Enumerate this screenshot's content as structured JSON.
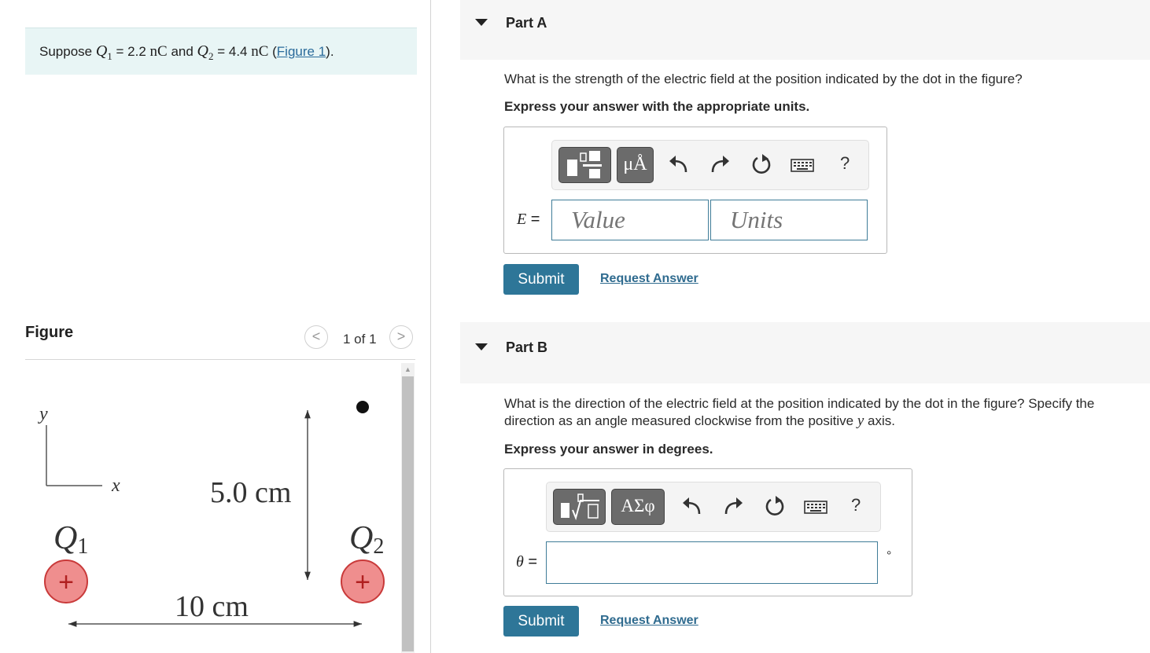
{
  "problem": {
    "prefix": "Suppose ",
    "q1_symbol": "Q",
    "q1_sub": "1",
    "q1_value": " = 2.2 ",
    "q1_unit": "nC",
    "conj": " and ",
    "q2_symbol": "Q",
    "q2_sub": "2",
    "q2_value": " = 4.4 ",
    "q2_unit": "nC",
    "open_paren": " (",
    "figure_link": "Figure 1",
    "close_paren": ")."
  },
  "figure_panel": {
    "heading": "Figure",
    "prev": "<",
    "counter": "1 of 1",
    "next": ">",
    "diagram": {
      "y_axis": "y",
      "x_axis": "x",
      "vertical_dim": "5.0 cm",
      "horizontal_dim": "10 cm",
      "charge1_symbol": "Q",
      "charge1_sub": "1",
      "charge2_symbol": "Q",
      "charge2_sub": "2",
      "plus": "+"
    }
  },
  "partA": {
    "title": "Part A",
    "question": "What is the strength of the electric field at the position indicated by the dot in the figure?",
    "instruction": "Express your answer with the appropriate units.",
    "toolbar": {
      "units_btn": "μÅ",
      "help": "?"
    },
    "label_var": "E",
    "label_eq": " =",
    "value_placeholder": "Value",
    "units_placeholder": "Units",
    "submit": "Submit",
    "request": "Request Answer"
  },
  "partB": {
    "title": "Part B",
    "question_pre": "What is the direction of the electric field at the position indicated by the dot in the figure? Specify the direction as an angle measured clockwise from the positive ",
    "question_var": "y",
    "question_post": " axis.",
    "instruction": "Express your answer in degrees.",
    "toolbar": {
      "greek_btn": "ΑΣφ",
      "help": "?"
    },
    "label_var": "θ",
    "label_eq": " =",
    "answer_value": "",
    "degree_symbol": "°",
    "submit": "Submit",
    "request": "Request Answer"
  },
  "colors": {
    "accent": "#2e7698",
    "link": "#2a6b9b",
    "problem_bg": "#e8f5f5",
    "charge_fill": "#ef8e8e",
    "charge_stroke": "#c93a3a"
  }
}
